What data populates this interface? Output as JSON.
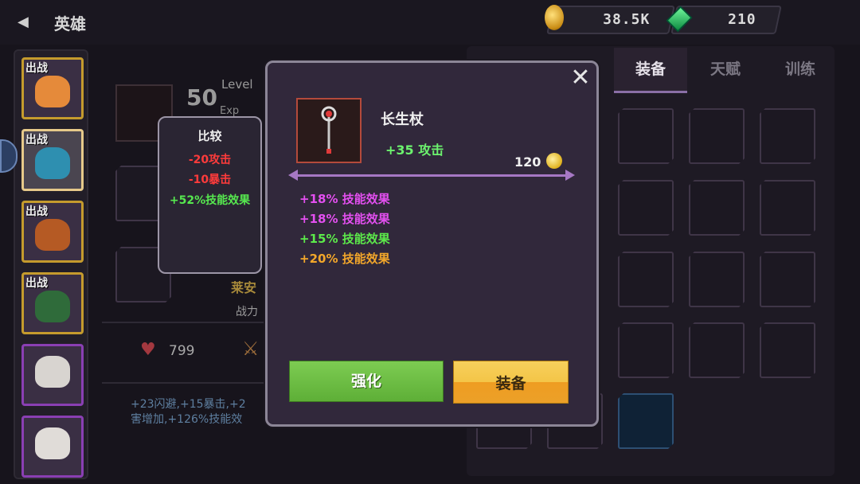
{
  "header": {
    "back_icon": "back-arrow-icon",
    "title": "英雄"
  },
  "currency": {
    "gold": "38.5K",
    "gems": "210",
    "gold_icon": "gold-coin-icon",
    "gem_icon": "green-gem-icon"
  },
  "heroes": [
    {
      "tag": "出战",
      "color": "#c59b2d"
    },
    {
      "tag": "出战",
      "color": "#e6c98a"
    },
    {
      "tag": "出战",
      "color": "#c59b2d"
    },
    {
      "tag": "出战",
      "color": "#c59b2d"
    },
    {
      "tag": "",
      "color": "#8a3fb3"
    },
    {
      "tag": "",
      "color": "#8a3fb3"
    }
  ],
  "hero_info": {
    "level": "50",
    "level_label": "Level",
    "exp_label": "Exp",
    "name": "莱安",
    "power_label": "战力",
    "hp": "799",
    "stats_line1": "+23闪避,+15暴击,+2",
    "stats_line2": "害增加,+126%技能效"
  },
  "tabs": [
    {
      "label": "装备"
    },
    {
      "label": "天赋"
    },
    {
      "label": "训练"
    }
  ],
  "compare": {
    "title": "比较",
    "lines": [
      {
        "text": "-20攻击",
        "color": "#ff3b3b"
      },
      {
        "text": "-10暴击",
        "color": "#ff3b3b"
      },
      {
        "text": "+52%技能效果",
        "color": "#56e84f"
      }
    ]
  },
  "item": {
    "name": "长生杖",
    "attack": "+35 攻击",
    "price": "120",
    "bonuses": [
      {
        "text": "+18% 技能效果",
        "color": "#e34ff0"
      },
      {
        "text": "+18% 技能效果",
        "color": "#e34ff0"
      },
      {
        "text": "+15% 技能效果",
        "color": "#5cea4a"
      },
      {
        "text": "+20% 技能效果",
        "color": "#f3a72a"
      }
    ],
    "enhance_label": "强化",
    "equip_label": "装备"
  },
  "icons": {
    "close": "close-icon",
    "heart": "heart-icon",
    "sword": "sword-icon",
    "staff": "staff-icon"
  }
}
